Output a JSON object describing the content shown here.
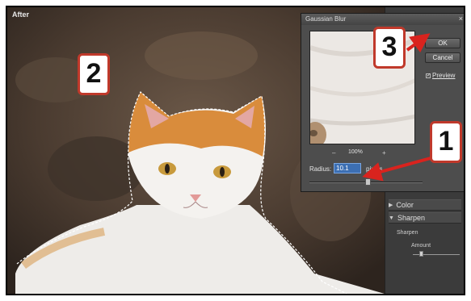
{
  "canvas": {
    "label": "After"
  },
  "dialog": {
    "title": "Gaussian Blur",
    "close": "×",
    "ok_label": "OK",
    "cancel_label": "Cancel",
    "preview_label": "Preview",
    "preview_checked": "✓",
    "zoom_minus": "–",
    "zoom_plus": "+",
    "zoom_value": "100%",
    "radius_label": "Radius:",
    "radius_value": "10.1",
    "radius_unit": "pixels"
  },
  "side_panel": {
    "color_label": "Color",
    "sharpen_label": "Sharpen",
    "sharpen_sub": "Sharpen",
    "amount_label": "Amount"
  },
  "callouts": {
    "one": "1",
    "two": "2",
    "three": "3"
  },
  "colors": {
    "callout_border": "#c0392b",
    "arrow": "#d9231e",
    "selection_input": "#3c6fb3"
  }
}
